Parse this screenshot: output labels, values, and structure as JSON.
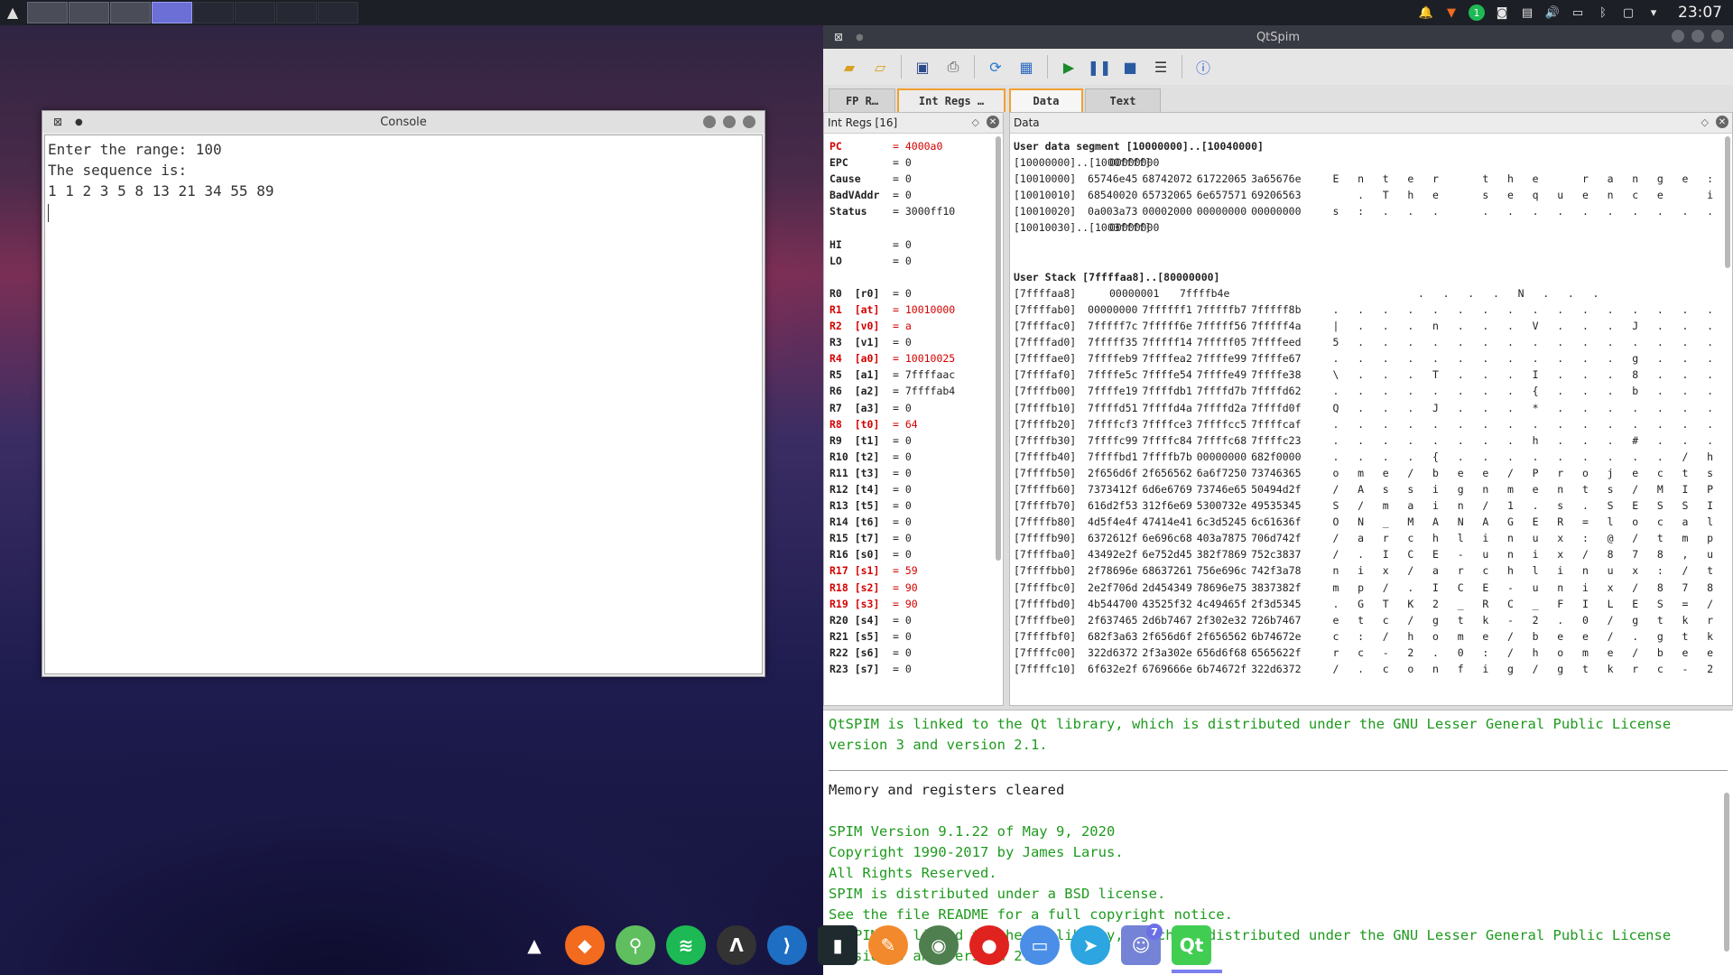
{
  "taskbar": {
    "launcher_icon": "mountain-logo-icon",
    "clock": "23:07",
    "tray": {
      "notification_badge": "1",
      "icons": [
        "bell-icon",
        "brave-icon",
        "notification-badge",
        "discord-icon",
        "clipboard-icon",
        "volume-icon",
        "battery-icon",
        "bluetooth-icon",
        "monitor-icon",
        "chevron-down-icon"
      ]
    }
  },
  "console": {
    "title": "Console",
    "lines": [
      "Enter the range: 100",
      "The sequence is:",
      "1 1 2 3 5 8 13 21 34 55 89"
    ]
  },
  "qtspim": {
    "title": "QtSpim",
    "tabs": [
      "FP R…",
      "Int Regs …",
      "Data",
      "Text"
    ],
    "regs_title": "Int Regs [16]",
    "data_title": "Data",
    "accent_color": "#f0a030",
    "changed_register_color": "#d40000",
    "registers": [
      {
        "name": "PC",
        "value": "= 4000a0",
        "changed": true
      },
      {
        "name": "EPC",
        "value": "= 0",
        "changed": false
      },
      {
        "name": "Cause",
        "value": "= 0",
        "changed": false
      },
      {
        "name": "BadVAddr",
        "value": "= 0",
        "changed": false
      },
      {
        "name": "Status",
        "value": "= 3000ff10",
        "changed": false
      },
      {
        "blank": true
      },
      {
        "name": "HI",
        "value": "= 0",
        "changed": false
      },
      {
        "name": "LO",
        "value": "= 0",
        "changed": false
      },
      {
        "blank": true
      },
      {
        "name": "R0  [r0]",
        "value": "= 0",
        "changed": false
      },
      {
        "name": "R1  [at]",
        "value": "= 10010000",
        "changed": true
      },
      {
        "name": "R2  [v0]",
        "value": "= a",
        "changed": true
      },
      {
        "name": "R3  [v1]",
        "value": "= 0",
        "changed": false
      },
      {
        "name": "R4  [a0]",
        "value": "= 10010025",
        "changed": true
      },
      {
        "name": "R5  [a1]",
        "value": "= 7ffffaac",
        "changed": false
      },
      {
        "name": "R6  [a2]",
        "value": "= 7ffffab4",
        "changed": false
      },
      {
        "name": "R7  [a3]",
        "value": "= 0",
        "changed": false
      },
      {
        "name": "R8  [t0]",
        "value": "= 64",
        "changed": true
      },
      {
        "name": "R9  [t1]",
        "value": "= 0",
        "changed": false
      },
      {
        "name": "R10 [t2]",
        "value": "= 0",
        "changed": false
      },
      {
        "name": "R11 [t3]",
        "value": "= 0",
        "changed": false
      },
      {
        "name": "R12 [t4]",
        "value": "= 0",
        "changed": false
      },
      {
        "name": "R13 [t5]",
        "value": "= 0",
        "changed": false
      },
      {
        "name": "R14 [t6]",
        "value": "= 0",
        "changed": false
      },
      {
        "name": "R15 [t7]",
        "value": "= 0",
        "changed": false
      },
      {
        "name": "R16 [s0]",
        "value": "= 0",
        "changed": false
      },
      {
        "name": "R17 [s1]",
        "value": "= 59",
        "changed": true
      },
      {
        "name": "R18 [s2]",
        "value": "= 90",
        "changed": true
      },
      {
        "name": "R19 [s3]",
        "value": "= 90",
        "changed": true
      },
      {
        "name": "R20 [s4]",
        "value": "= 0",
        "changed": false
      },
      {
        "name": "R21 [s5]",
        "value": "= 0",
        "changed": false
      },
      {
        "name": "R22 [s6]",
        "value": "= 0",
        "changed": false
      },
      {
        "name": "R23 [s7]",
        "value": "= 0",
        "changed": false
      }
    ],
    "data_rows": [
      {
        "head": "User data segment [10000000]..[10040000]"
      },
      {
        "addr": "[10000000]..[1000ffff]",
        "words": [
          "00000000"
        ],
        "ascii": ""
      },
      {
        "addr": "[10010000]",
        "words": [
          "65746e45",
          "68742072",
          "61722065",
          "3a65676e"
        ],
        "ascii": "E n t e r   t h e   r a n g e :"
      },
      {
        "addr": "[10010010]",
        "words": [
          "68540020",
          "65732065",
          "6e657571",
          "69206563"
        ],
        "ascii": "  . T h e   s e q u e n c e   i"
      },
      {
        "addr": "[10010020]",
        "words": [
          "0a003a73",
          "00002000",
          "00000000",
          "00000000"
        ],
        "ascii": "s : . . .   . . . . . . . . . ."
      },
      {
        "addr": "[10010030]..[1003ffff]",
        "words": [
          "00000000"
        ],
        "ascii": ""
      },
      {
        "blank": true
      },
      {
        "blank": true
      },
      {
        "head": "User Stack [7ffffaa8]..[80000000]"
      },
      {
        "addr": "[7ffffaa8]",
        "words": [
          "00000001",
          "7ffffb4e"
        ],
        "ascii": ". . . . N . . ."
      },
      {
        "addr": "[7ffffab0]",
        "words": [
          "00000000",
          "7ffffff1",
          "7fffffb7",
          "7fffff8b"
        ],
        "ascii": ". . . . . . . . . . . . . . . ."
      },
      {
        "addr": "[7ffffac0]",
        "words": [
          "7fffff7c",
          "7fffff6e",
          "7fffff56",
          "7fffff4a"
        ],
        "ascii": "| . . . n . . . V . . . J . . ."
      },
      {
        "addr": "[7ffffad0]",
        "words": [
          "7fffff35",
          "7fffff14",
          "7fffff05",
          "7ffffeed"
        ],
        "ascii": "5 . . . . . . . . . . . . . . ."
      },
      {
        "addr": "[7ffffae0]",
        "words": [
          "7ffffeb9",
          "7ffffea2",
          "7ffffe99",
          "7ffffe67"
        ],
        "ascii": ". . . . . . . . . . . . g . . ."
      },
      {
        "addr": "[7ffffaf0]",
        "words": [
          "7ffffe5c",
          "7ffffe54",
          "7ffffe49",
          "7ffffe38"
        ],
        "ascii": "\\ . . . T . . . I . . . 8 . . ."
      },
      {
        "addr": "[7ffffb00]",
        "words": [
          "7ffffe19",
          "7ffffdb1",
          "7ffffd7b",
          "7ffffd62"
        ],
        "ascii": ". . . . . . . . { . . . b . . ."
      },
      {
        "addr": "[7ffffb10]",
        "words": [
          "7ffffd51",
          "7ffffd4a",
          "7ffffd2a",
          "7ffffd0f"
        ],
        "ascii": "Q . . . J . . . * . . . . . . ."
      },
      {
        "addr": "[7ffffb20]",
        "words": [
          "7ffffcf3",
          "7ffffce3",
          "7ffffcc5",
          "7ffffcaf"
        ],
        "ascii": ". . . . . . . . . . . . . . . ."
      },
      {
        "addr": "[7ffffb30]",
        "words": [
          "7ffffc99",
          "7ffffc84",
          "7ffffc68",
          "7ffffc23"
        ],
        "ascii": ". . . . . . . . h . . . # . . ."
      },
      {
        "addr": "[7ffffb40]",
        "words": [
          "7ffffbd1",
          "7ffffb7b",
          "00000000",
          "682f0000"
        ],
        "ascii": ". . . . { . . . . . . . . . / h"
      },
      {
        "addr": "[7ffffb50]",
        "words": [
          "2f656d6f",
          "2f656562",
          "6a6f7250",
          "73746365"
        ],
        "ascii": "o m e / b e e / P r o j e c t s"
      },
      {
        "addr": "[7ffffb60]",
        "words": [
          "7373412f",
          "6d6e6769",
          "73746e65",
          "50494d2f"
        ],
        "ascii": "/ A s s i g n m e n t s / M I P"
      },
      {
        "addr": "[7ffffb70]",
        "words": [
          "616d2f53",
          "312f6e69",
          "5300732e",
          "49535345"
        ],
        "ascii": "S / m a i n / 1 . s . S E S S I"
      },
      {
        "addr": "[7ffffb80]",
        "words": [
          "4d5f4e4f",
          "47414e41",
          "6c3d5245",
          "6c61636f"
        ],
        "ascii": "O N _ M A N A G E R = l o c a l"
      },
      {
        "addr": "[7ffffb90]",
        "words": [
          "6372612f",
          "6e696c68",
          "403a7875",
          "706d742f"
        ],
        "ascii": "/ a r c h l i n u x : @ / t m p"
      },
      {
        "addr": "[7ffffba0]",
        "words": [
          "43492e2f",
          "6e752d45",
          "382f7869",
          "752c3837"
        ],
        "ascii": "/ . I C E - u n i x / 8 7 8 , u"
      },
      {
        "addr": "[7ffffbb0]",
        "words": [
          "2f78696e",
          "68637261",
          "756e696c",
          "742f3a78"
        ],
        "ascii": "n i x / a r c h l i n u x : / t"
      },
      {
        "addr": "[7ffffbc0]",
        "words": [
          "2e2f706d",
          "2d454349",
          "78696e75",
          "3837382f"
        ],
        "ascii": "m p / . I C E - u n i x / 8 7 8"
      },
      {
        "addr": "[7ffffbd0]",
        "words": [
          "4b544700",
          "43525f32",
          "4c49465f",
          "2f3d5345"
        ],
        "ascii": ". G T K 2 _ R C _ F I L E S = /"
      },
      {
        "addr": "[7ffffbe0]",
        "words": [
          "2f637465",
          "2d6b7467",
          "2f302e32",
          "726b7467"
        ],
        "ascii": "e t c / g t k - 2 . 0 / g t k r"
      },
      {
        "addr": "[7ffffbf0]",
        "words": [
          "682f3a63",
          "2f656d6f",
          "2f656562",
          "6b74672e"
        ],
        "ascii": "c : / h o m e / b e e / . g t k"
      },
      {
        "addr": "[7ffffc00]",
        "words": [
          "322d6372",
          "2f3a302e",
          "656d6f68",
          "6565622f"
        ],
        "ascii": "r c - 2 . 0 : / h o m e / b e e"
      },
      {
        "addr": "[7ffffc10]",
        "words": [
          "6f632e2f",
          "6769666e",
          "6b74672f",
          "322d6372"
        ],
        "ascii": "/ . c o n f i g / g t k r c - 2"
      }
    ],
    "log": [
      {
        "type": "green",
        "text": "QtSPIM is linked to the Qt library, which is distributed under the GNU Lesser General Public License"
      },
      {
        "type": "green",
        "text": "version 3 and version 2.1."
      },
      {
        "type": "rule"
      },
      {
        "type": "black",
        "text": "Memory and registers cleared"
      },
      {
        "type": "blank"
      },
      {
        "type": "green",
        "text": "SPIM Version 9.1.22 of May 9, 2020"
      },
      {
        "type": "green",
        "text": "Copyright 1990-2017 by James Larus."
      },
      {
        "type": "green",
        "text": "All Rights Reserved."
      },
      {
        "type": "green",
        "text": "SPIM is distributed under a BSD license."
      },
      {
        "type": "green",
        "text": "See the file README for a full copyright notice."
      },
      {
        "type": "green",
        "text": "QtSPIM is linked to the Qt library, which is distributed under the GNU Lesser General Public License"
      },
      {
        "type": "green",
        "text": "version 3 and version 2.1."
      }
    ]
  },
  "dock": {
    "items": [
      {
        "name": "mountain-logo-icon",
        "label": "",
        "color": "transparent"
      },
      {
        "name": "brave-browser-icon",
        "label": "",
        "color": "#f36b1f"
      },
      {
        "name": "maps-pin-icon",
        "label": "",
        "color": "#5fbf5f"
      },
      {
        "name": "spotify-icon",
        "label": "",
        "color": "#1db954"
      },
      {
        "name": "arch-launcher-icon",
        "label": "",
        "color": "#333333"
      },
      {
        "name": "vscode-icon",
        "label": "",
        "color": "#1e6fc4"
      },
      {
        "name": "terminal-icon",
        "label": "",
        "color": "#1f2a2e"
      },
      {
        "name": "draw-pen-icon",
        "label": "",
        "color": "#f28a2d"
      },
      {
        "name": "android-studio-icon",
        "label": "",
        "color": "#4f7f4f"
      },
      {
        "name": "tomato-timer-icon",
        "label": "",
        "color": "#e0231f"
      },
      {
        "name": "files-folder-icon",
        "label": "",
        "color": "#4a8ee8"
      },
      {
        "name": "telegram-icon",
        "label": "",
        "color": "#2ca5e0"
      },
      {
        "name": "discord-icon",
        "label": "",
        "color": "#7583d6",
        "badge": "7"
      },
      {
        "name": "qt-creator-icon",
        "label": "Qt",
        "color": "#41cd52"
      }
    ]
  }
}
